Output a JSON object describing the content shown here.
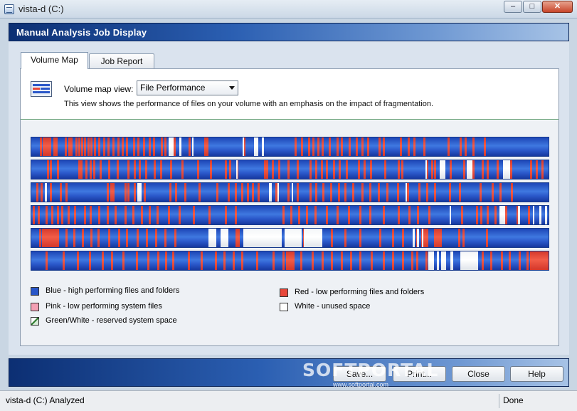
{
  "window": {
    "title": "vista-d (C:)",
    "minimize": "–",
    "maximize": "□",
    "close": "✕"
  },
  "header": {
    "title": "Manual Analysis Job Display"
  },
  "tabs": [
    {
      "label": "Volume Map",
      "active": true
    },
    {
      "label": "Job Report",
      "active": false
    }
  ],
  "view": {
    "label": "Volume map view:",
    "selected": "File Performance",
    "description": "This view shows the performance of files on your volume with an emphasis on the impact of fragmentation."
  },
  "colors": {
    "blue": "#2a57c9",
    "red": "#e8473a",
    "pink": "#f4a0b4",
    "white": "#ffffff",
    "reserved": "#d7ecd7"
  },
  "volume_map": {
    "rows": [
      {
        "red": [
          0.017,
          0.022,
          0.026,
          0.03,
          0.034,
          0.042,
          0.046,
          0.064,
          0.071,
          0.076,
          0.085,
          0.09,
          0.096,
          0.102,
          0.108,
          0.114,
          0.121,
          0.129,
          0.139,
          0.147,
          0.156,
          0.166,
          0.174,
          0.183,
          0.196,
          0.204,
          0.215,
          0.226,
          0.234,
          0.249,
          0.256,
          0.275,
          0.303,
          0.333,
          0.338,
          0.409,
          0.507,
          0.52,
          0.533,
          0.542,
          0.552,
          0.56,
          0.574,
          0.588,
          0.597,
          0.612,
          0.625,
          0.637,
          0.648,
          0.67,
          0.678,
          0.71,
          0.726,
          0.737,
          0.756,
          0.802,
          0.826,
          0.835,
          0.851,
          0.872
        ],
        "white": [
          [
            0.265,
            0.01
          ],
          [
            0.286,
            0.003
          ],
          [
            0.31,
            0.003
          ],
          [
            0.408,
            0.002
          ],
          [
            0.43,
            0.007
          ],
          [
            0.444,
            0.005
          ]
        ]
      },
      {
        "red": [
          0.03,
          0.035,
          0.05,
          0.09,
          0.094,
          0.104,
          0.113,
          0.12,
          0.132,
          0.148,
          0.165,
          0.185,
          0.198,
          0.207,
          0.219,
          0.236,
          0.248,
          0.267,
          0.289,
          0.32,
          0.344,
          0.373,
          0.382,
          0.395,
          0.448,
          0.453,
          0.463,
          0.476,
          0.494,
          0.512,
          0.536,
          0.548,
          0.558,
          0.568,
          0.581,
          0.593,
          0.606,
          0.63,
          0.64,
          0.653,
          0.681,
          0.707,
          0.713,
          0.762,
          0.771,
          0.777,
          0.806,
          0.833,
          0.85,
          0.868,
          0.878,
          0.897,
          0.923,
          0.962,
          0.973,
          0.983
        ],
        "white": [
          [
            0.395,
            0.003
          ],
          [
            0.788,
            0.01
          ],
          [
            0.839,
            0.012
          ],
          [
            0.909,
            0.014
          ],
          [
            0.76,
            0.003
          ]
        ]
      },
      {
        "red": [
          0.01,
          0.018,
          0.035,
          0.055,
          0.066,
          0.146,
          0.152,
          0.157,
          0.18,
          0.185,
          0.198,
          0.217,
          0.266,
          0.277,
          0.295,
          0.323,
          0.357,
          0.379,
          0.393,
          0.405,
          0.415,
          0.425,
          0.436,
          0.458,
          0.47,
          0.494,
          0.511,
          0.536,
          0.548,
          0.561,
          0.576,
          0.591,
          0.604,
          0.619,
          0.637,
          0.652,
          0.668,
          0.685,
          0.705,
          0.724,
          0.746,
          0.762,
          0.776,
          0.805,
          0.825,
          0.864,
          0.888,
          0.902,
          0.924
        ],
        "white": [
          [
            0.026,
            0.004
          ],
          [
            0.205,
            0.008
          ],
          [
            0.458,
            0.005
          ],
          [
            0.475,
            0.003
          ],
          [
            0.502,
            0.003
          ],
          [
            0.721,
            0.003
          ]
        ]
      },
      {
        "red": [
          0.003,
          0.012,
          0.028,
          0.038,
          0.05,
          0.058,
          0.07,
          0.082,
          0.102,
          0.113,
          0.129,
          0.146,
          0.161,
          0.18,
          0.195,
          0.211,
          0.226,
          0.242,
          0.263,
          0.284,
          0.311,
          0.342,
          0.373,
          0.393,
          0.484,
          0.499,
          0.515,
          0.53,
          0.546,
          0.568,
          0.589,
          0.611,
          0.633,
          0.652,
          0.677,
          0.706,
          0.727,
          0.744,
          0.766,
          0.829,
          0.857,
          0.866,
          0.878,
          0.893,
          0.914,
          0.936,
          0.957
        ],
        "white": [
          [
            0.807,
            0.002
          ],
          [
            0.902,
            0.012
          ],
          [
            0.938,
            0.004
          ],
          [
            0.967,
            0.003
          ],
          [
            0.979,
            0.005
          ],
          [
            0.991,
            0.003
          ]
        ]
      },
      {
        "red": [
          0.015,
          0.027,
          0.05,
          0.066,
          0.081,
          0.097,
          0.114,
          0.128,
          0.148,
          0.168,
          0.182,
          0.203,
          0.221,
          0.238,
          0.257,
          0.276,
          0.353,
          0.423,
          0.524,
          0.537,
          0.556,
          0.578,
          0.603,
          0.632,
          0.671,
          0.696,
          0.715,
          0.742,
          0.761,
          0.777,
          0.823,
          0.831,
          0.877
        ],
        "red_wide": [
          [
            0.02,
            0.03
          ],
          [
            0.394,
            0.008
          ],
          [
            0.752,
            0.012
          ],
          [
            0.78,
            0.012
          ]
        ],
        "white": [
          [
            0.342,
            0.015
          ],
          [
            0.365,
            0.015
          ],
          [
            0.409,
            0.074
          ],
          [
            0.488,
            0.033
          ],
          [
            0.526,
            0.035
          ],
          [
            0.735,
            0.005
          ],
          [
            0.743,
            0.004
          ],
          [
            0.753,
            0.003
          ]
        ]
      },
      {
        "red": [
          0.028,
          0.06,
          0.088,
          0.111,
          0.136,
          0.154,
          0.176,
          0.201,
          0.223,
          0.243,
          0.258,
          0.272,
          0.302,
          0.326,
          0.354,
          0.37,
          0.388,
          0.405,
          0.434,
          0.465,
          0.484,
          0.503,
          0.519,
          0.54,
          0.559,
          0.578,
          0.597,
          0.614,
          0.632,
          0.655,
          0.678,
          0.695,
          0.714,
          0.733,
          0.742,
          0.76,
          0.868,
          0.885,
          0.905,
          0.921,
          0.939,
          0.955
        ],
        "red_wide": [
          [
            0.491,
            0.012
          ],
          [
            0.962,
            0.037
          ]
        ],
        "white": [
          [
            0.766,
            0.01
          ],
          [
            0.782,
            0.004
          ],
          [
            0.79,
            0.01
          ],
          [
            0.808,
            0.006
          ],
          [
            0.827,
            0.034
          ]
        ]
      }
    ]
  },
  "legend": [
    {
      "label": "Blue - high performing files and folders",
      "color": "#2a57c9"
    },
    {
      "label": "Red - low performing files and folders",
      "color": "#e8473a"
    },
    {
      "label": "Pink - low performing system files",
      "color": "#f4a0b4"
    },
    {
      "label": "White - unused space",
      "color": "#ffffff"
    },
    {
      "label": "Green/White - reserved system space",
      "color": "#d7ecd7"
    }
  ],
  "footer": {
    "buttons": [
      "Save...",
      "Print...",
      "Close",
      "Help"
    ],
    "watermark": "SOFTPORTAL",
    "watermark_url": "www.softportal.com"
  },
  "status": {
    "left": "vista-d (C:) Analyzed",
    "right": "Done"
  }
}
